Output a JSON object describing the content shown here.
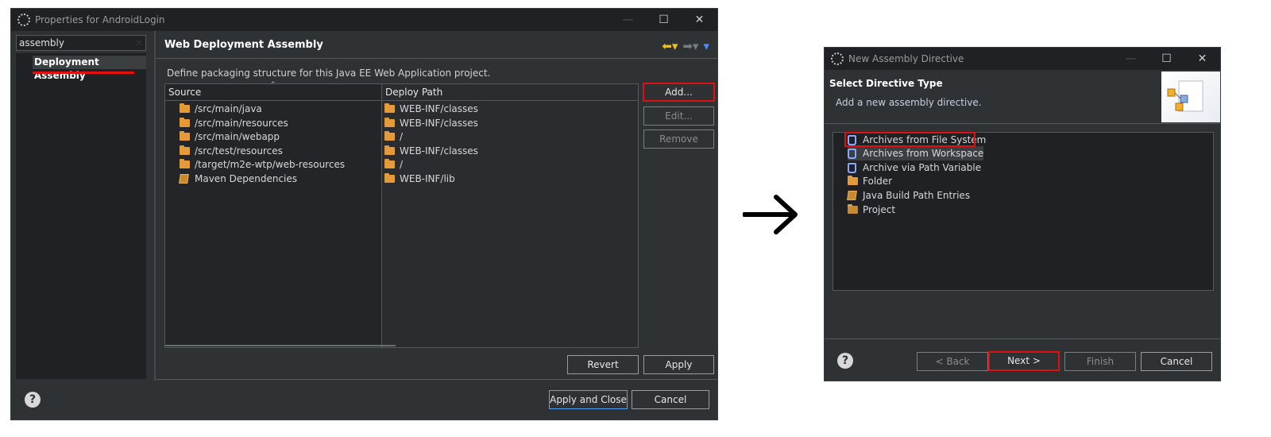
{
  "left_dialog": {
    "title": "Properties for AndroidLogin",
    "window_buttons": {
      "minimize": "—",
      "maximize": "☐",
      "close": "✕"
    },
    "filter_value": "assembly",
    "filter_clear": "✕",
    "nav_selected": "Deployment Assembly",
    "page_title": "Web Deployment Assembly",
    "description": "Define packaging structure for this Java EE Web Application project.",
    "columns": {
      "source": "Source",
      "deploy_path": "Deploy Path"
    },
    "rows": [
      {
        "source": "/src/main/java",
        "deploy": "WEB-INF/classes",
        "icon": "folder-icon"
      },
      {
        "source": "/src/main/resources",
        "deploy": "WEB-INF/classes",
        "icon": "folder-icon"
      },
      {
        "source": "/src/main/webapp",
        "deploy": "/",
        "icon": "folder-icon"
      },
      {
        "source": "/src/test/resources",
        "deploy": "WEB-INF/classes",
        "icon": "folder-icon"
      },
      {
        "source": "/target/m2e-wtp/web-resources",
        "deploy": "/",
        "icon": "folder-icon"
      },
      {
        "source": "Maven Dependencies",
        "deploy": "WEB-INF/lib",
        "icon": "library-icon"
      }
    ],
    "buttons": {
      "add": "Add...",
      "edit": "Edit...",
      "remove": "Remove",
      "revert": "Revert",
      "apply": "Apply",
      "apply_close": "Apply and Close",
      "cancel": "Cancel"
    },
    "help": "?"
  },
  "right_dialog": {
    "title": "New Assembly Directive",
    "window_buttons": {
      "minimize": "—",
      "maximize": "☐",
      "close": "✕"
    },
    "heading": "Select Directive Type",
    "subheading": "Add a new assembly directive.",
    "items": [
      {
        "label": "Archives from File System",
        "icon": "jar-bottle-icon"
      },
      {
        "label": "Archives from Workspace",
        "icon": "jar-bottle-icon"
      },
      {
        "label": "Archive via Path Variable",
        "icon": "jar-bottle-icon"
      },
      {
        "label": "Folder",
        "icon": "folder-icon"
      },
      {
        "label": "Java Build Path Entries",
        "icon": "library-icon"
      },
      {
        "label": "Project",
        "icon": "open-folder-icon"
      }
    ],
    "buttons": {
      "back": "< Back",
      "next": "Next >",
      "finish": "Finish",
      "cancel": "Cancel"
    },
    "help": "?"
  },
  "colors": {
    "highlight_red": "#e01010",
    "dark_bg": "#2f3235",
    "list_bg": "#1f2124",
    "folder": "#e39b3a",
    "jar": "#8aa8ff"
  }
}
